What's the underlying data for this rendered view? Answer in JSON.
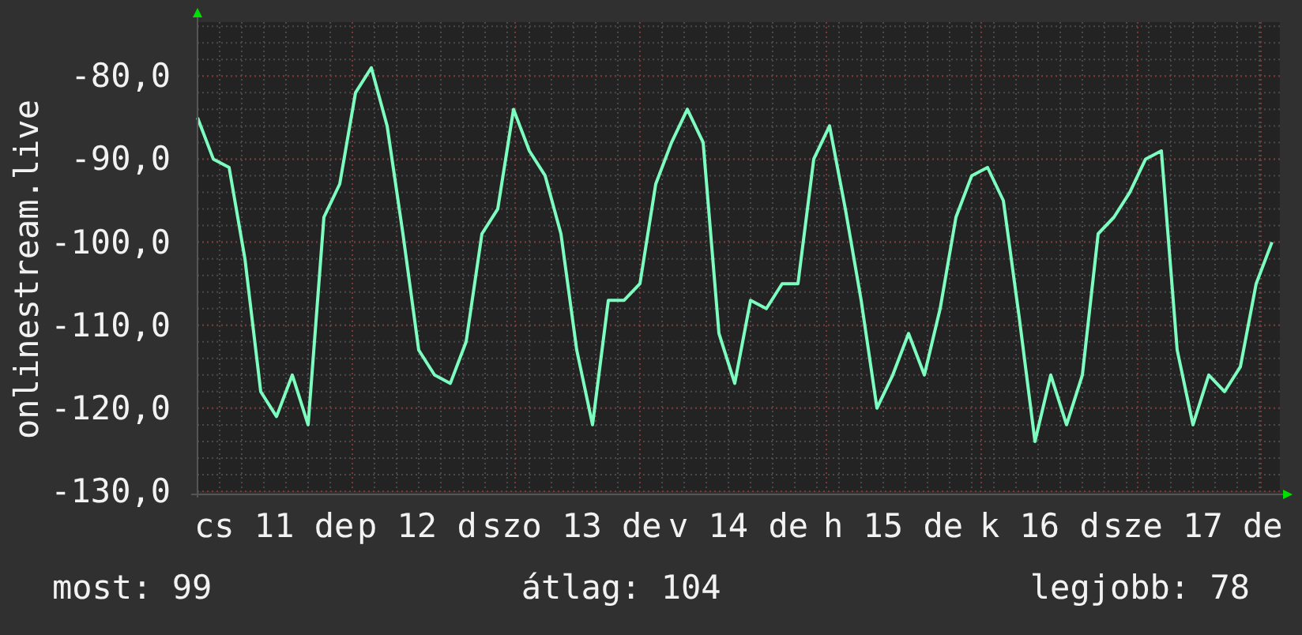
{
  "graph": {
    "chart_data": {
      "type": "line",
      "ylabel": "onlinestream.live",
      "ylim": [
        -130,
        -73.5
      ],
      "grid": true,
      "yticks": [
        {
          "value": -130,
          "label": "-130,0"
        },
        {
          "value": -120,
          "label": "-120,0"
        },
        {
          "value": -110,
          "label": "-110,0"
        },
        {
          "value": -100,
          "label": "-100,0"
        },
        {
          "value": -90,
          "label": "-90,0"
        },
        {
          "value": -80,
          "label": "-80,0"
        }
      ],
      "series": [
        {
          "color": "#7dfcc0",
          "values": [
            -85,
            -90,
            -91,
            -102,
            -118,
            -121,
            -116,
            -122,
            -97,
            -93,
            -82,
            -79,
            -86,
            -99,
            -113,
            -116,
            -117,
            -112,
            -99,
            -96,
            -84,
            -89,
            -92,
            -99,
            -113,
            -122,
            -107,
            -107,
            -105,
            -93,
            -88,
            -84,
            -88,
            -111,
            -117,
            -107,
            -108,
            -105,
            -105,
            -90,
            -86,
            -96,
            -107,
            -120,
            -116,
            -111,
            -116,
            -108,
            -97,
            -92,
            -91,
            -95,
            -109,
            -124,
            -116,
            -122,
            -116,
            -99,
            -97,
            -94,
            -90,
            -89,
            -113,
            -122,
            -116,
            -118,
            -115,
            -105,
            -100
          ]
        }
      ]
    },
    "x_axis_labels": [
      "cs 11 de",
      "p 12 d",
      "szo 13 de",
      "v 14 de",
      "h 15 de",
      "k 16 d",
      "sze 17 de"
    ]
  },
  "legend": [
    "most: 99",
    "átlag: 104",
    "legjobb: 78"
  ]
}
